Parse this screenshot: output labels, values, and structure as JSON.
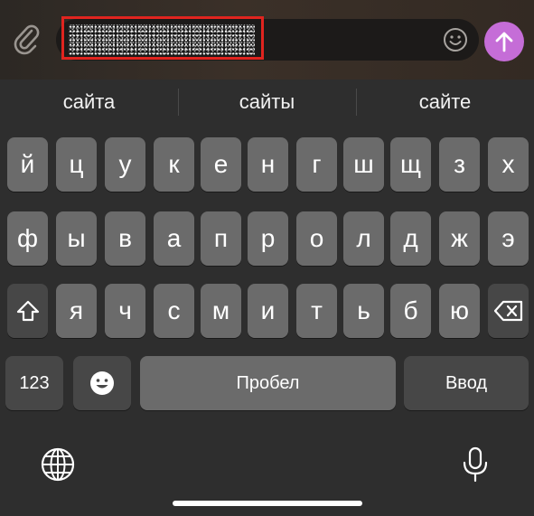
{
  "compose": {
    "attach_icon": "paperclip-icon",
    "emoji_icon": "smiley-face-icon",
    "send_icon": "arrow-up-icon",
    "send_color": "#c56dd7",
    "highlight_color": "#e0241f"
  },
  "suggestions": [
    "сайта",
    "сайты",
    "сайте"
  ],
  "keyboard": {
    "row1": [
      "й",
      "ц",
      "у",
      "к",
      "е",
      "н",
      "г",
      "ш",
      "щ",
      "з",
      "х"
    ],
    "row2": [
      "ф",
      "ы",
      "в",
      "а",
      "п",
      "р",
      "о",
      "л",
      "д",
      "ж",
      "э"
    ],
    "row3": [
      "я",
      "ч",
      "с",
      "м",
      "и",
      "т",
      "ь",
      "б",
      "ю"
    ],
    "shift_icon": "shift-arrow-icon",
    "backspace_icon": "backspace-icon",
    "numbers_label": "123",
    "emoji_key_icon": "emoji-icon",
    "space_label": "Пробел",
    "return_label": "Ввод",
    "globe_icon": "globe-icon",
    "mic_icon": "microphone-icon"
  }
}
